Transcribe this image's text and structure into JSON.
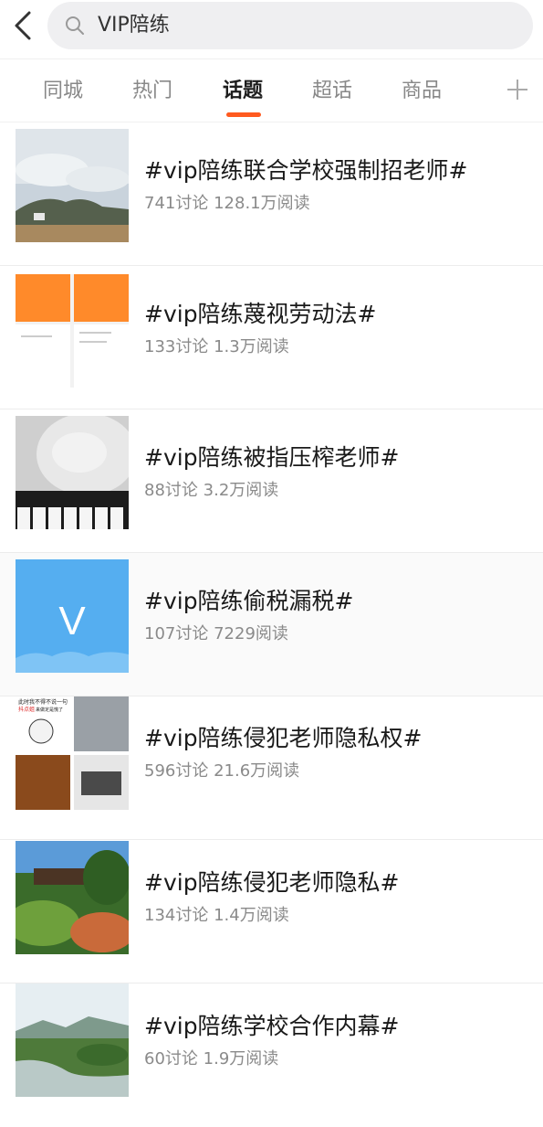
{
  "search": {
    "query": "VIP陪练"
  },
  "tabs": [
    "同城",
    "热门",
    "话题",
    "超话",
    "商品"
  ],
  "active_tab": "话题",
  "topics": [
    {
      "title": "#vip陪练联合学校强制招老师#",
      "discussions": "741讨论",
      "reads": "128.1万阅读",
      "thumb": "landscape-hill"
    },
    {
      "title": "#vip陪练蔑视劳动法#",
      "discussions": "133讨论",
      "reads": "1.3万阅读",
      "thumb": "screenshot-orange"
    },
    {
      "title": "#vip陪练被指压榨老师#",
      "discussions": "88讨论",
      "reads": "3.2万阅读",
      "thumb": "child-piano"
    },
    {
      "title": "#vip陪练偷税漏税#",
      "discussions": "107讨论",
      "reads": "7229阅读",
      "thumb": "v-logo",
      "thumb_text": "V"
    },
    {
      "title": "#vip陪练侵犯老师隐私权#",
      "discussions": "596讨论",
      "reads": "21.6万阅读",
      "thumb": "meme-collage",
      "thumb_text_1": "此时我不得不说一句",
      "thumb_text_2": "抖点姐",
      "thumb_text_3": "来做定是慌了"
    },
    {
      "title": "#vip陪练侵犯老师隐私#",
      "discussions": "134讨论",
      "reads": "1.4万阅读",
      "thumb": "pavilion-trees"
    },
    {
      "title": "#vip陪练学校合作内幕#",
      "discussions": "60讨论",
      "reads": "1.9万阅读",
      "thumb": "river-valley"
    }
  ],
  "colors": {
    "accent": "#ff5a1f",
    "v_logo": "#55aef0"
  }
}
